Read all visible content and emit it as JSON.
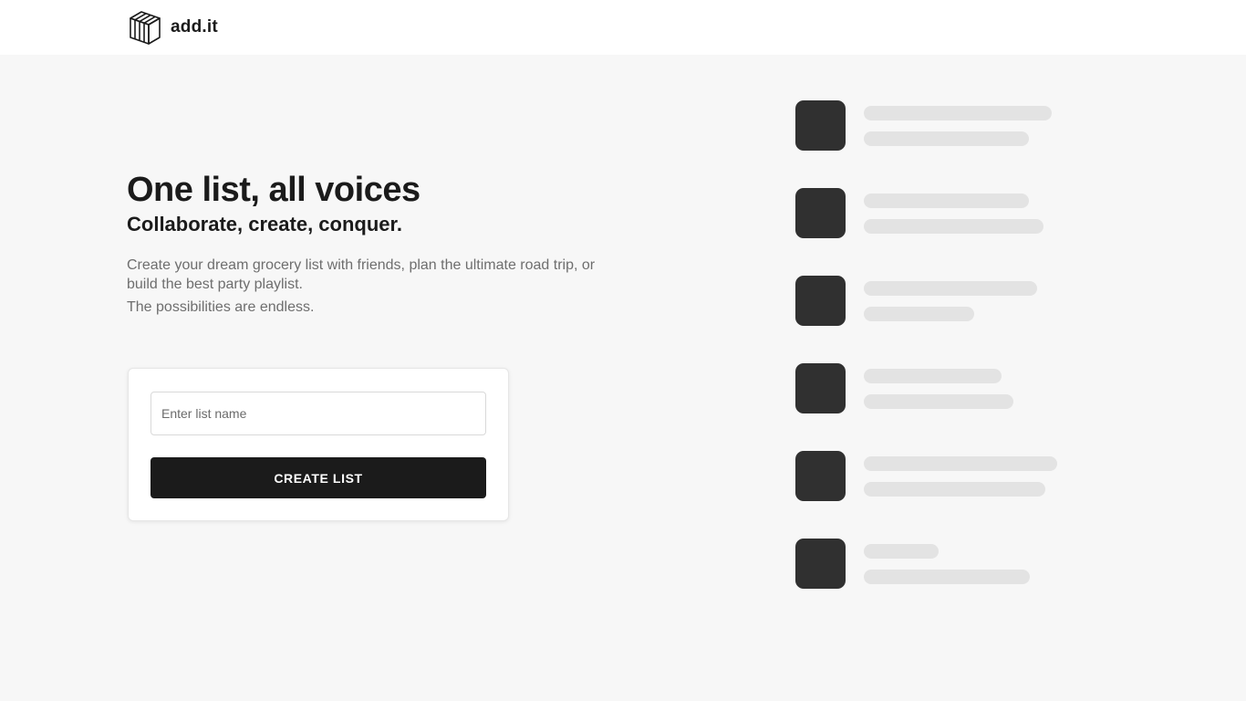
{
  "header": {
    "brand_name": "add.it",
    "logo_icon": "box-icon"
  },
  "hero": {
    "title": "One list, all voices",
    "subtitle": "Collaborate, create, conquer.",
    "description": "Create your dream grocery list with friends, plan the ultimate road trip, or build the best party playlist.",
    "description_2": "The possibilities are endless."
  },
  "form": {
    "input_placeholder": "Enter list name",
    "input_value": "",
    "create_button_label": "CREATE LIST"
  },
  "colors": {
    "page_background": "#f7f7f7",
    "header_background": "#ffffff",
    "primary_button": "#1b1b1b",
    "thumb": "#303030",
    "skeleton": "#e3e3e3",
    "muted_text": "#6e6e6e"
  }
}
